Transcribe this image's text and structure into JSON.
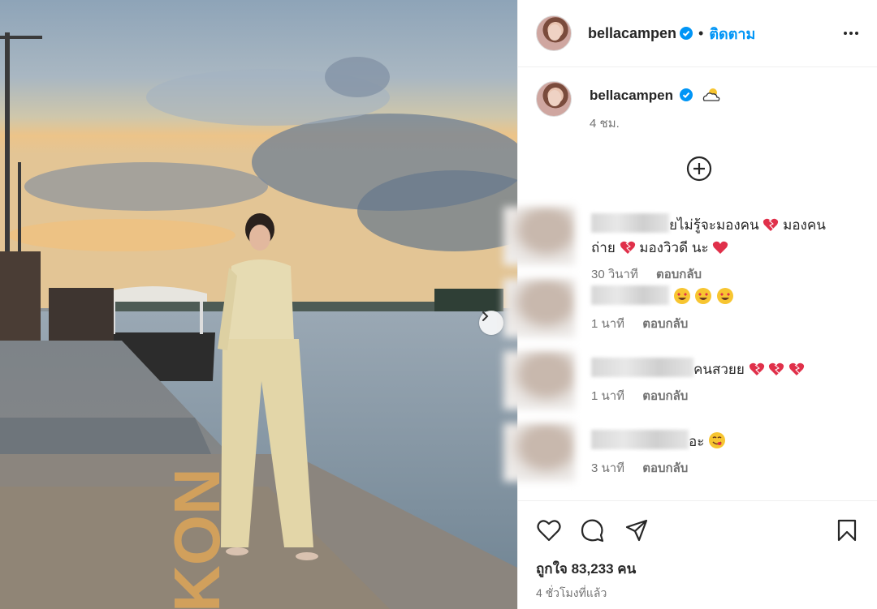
{
  "post": {
    "author": "bellacampen",
    "follow_label": "ติดตาม",
    "caption_time": "4 ชม.",
    "likes_text": "ถูกใจ 83,233 คน",
    "posted_ago": "4 ชั่วโมงที่แล้ว",
    "photo_text": "KON"
  },
  "icons": {
    "verified": "verified-badge-icon",
    "more": "more-options-icon",
    "weather": "sun-behind-cloud-icon",
    "add": "add-circle-icon",
    "next": "chevron-right-icon",
    "like": "heart-outline-icon",
    "comment": "comment-icon",
    "share": "send-icon",
    "save": "bookmark-icon"
  },
  "comments": [
    {
      "text_part1": "ยไม่รู้จะมองคน",
      "text_part2": " มองคน",
      "text_line2a": "ถ่าย",
      "text_line2b": " มองวิวดี นะ ",
      "time": "30 วินาที",
      "reply_label": "ตอบกลับ"
    },
    {
      "time": "1 นาที",
      "reply_label": "ตอบกลับ"
    },
    {
      "text_part1": "คนสวยย",
      "time": "1 นาที",
      "reply_label": "ตอบกลับ"
    },
    {
      "text_part1": "อะ",
      "time": "3 นาที",
      "reply_label": "ตอบกลับ"
    }
  ],
  "colors": {
    "accent": "#0095f6",
    "verified": "#0095f6",
    "heart": "#e0304a",
    "muted": "#737373"
  }
}
